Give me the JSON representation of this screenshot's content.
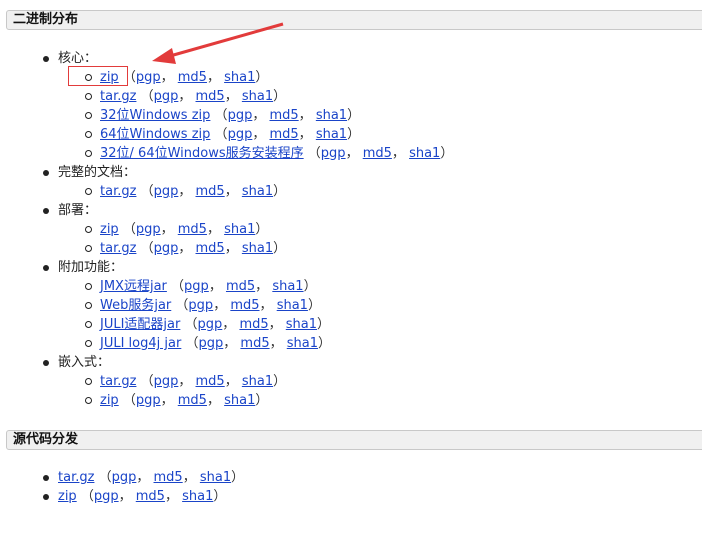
{
  "binary": {
    "title": "二进制分布",
    "sections": [
      {
        "label": "核心：",
        "items": [
          {
            "link": "zip"
          },
          {
            "link": "tar.gz"
          },
          {
            "link": "32位Windows zip"
          },
          {
            "link": "64位Windows zip"
          },
          {
            "link": "32位/ 64位Windows服务安装程序"
          }
        ]
      },
      {
        "label": "完整的文档：",
        "items": [
          {
            "link": "tar.gz"
          }
        ]
      },
      {
        "label": "部署：",
        "items": [
          {
            "link": "zip"
          },
          {
            "link": "tar.gz"
          }
        ]
      },
      {
        "label": "附加功能：",
        "items": [
          {
            "link": "JMX远程jar"
          },
          {
            "link": "Web服务jar"
          },
          {
            "link": "JULI适配器jar"
          },
          {
            "link": "JULI log4j jar"
          }
        ]
      },
      {
        "label": "嵌入式：",
        "items": [
          {
            "link": "tar.gz"
          },
          {
            "link": "zip"
          }
        ]
      }
    ]
  },
  "source": {
    "title": "源代码分发",
    "items": [
      {
        "link": "tar.gz"
      },
      {
        "link": "zip"
      }
    ]
  },
  "sig": {
    "pgp": "pgp",
    "md5": "md5",
    "sha1": "sha1",
    "open": "（",
    "close": "）",
    "comma": "，"
  },
  "annotation": {
    "color": "#e23b3b"
  }
}
